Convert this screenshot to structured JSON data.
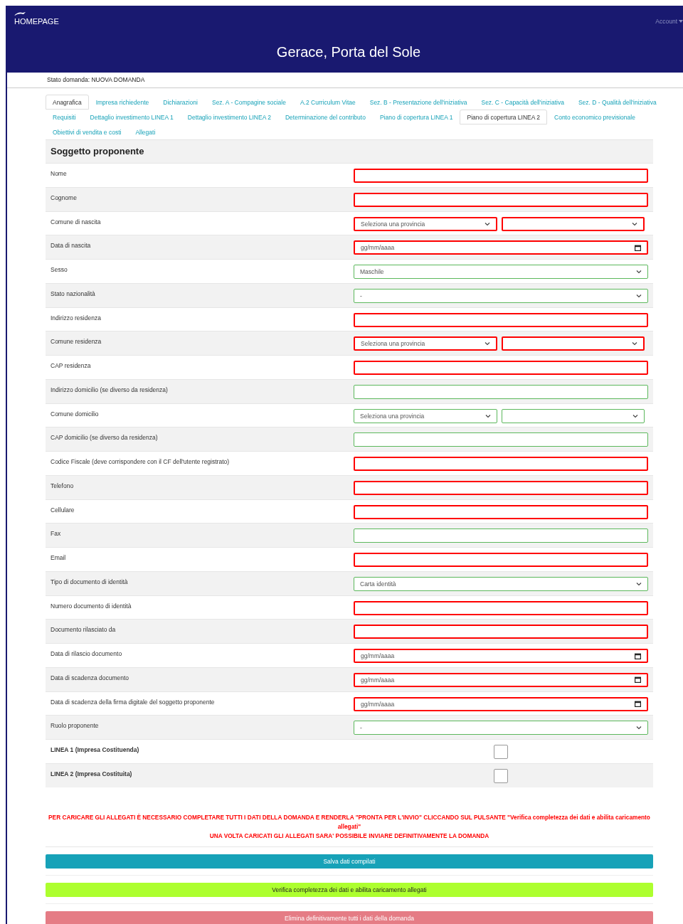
{
  "header": {
    "brand": "HOMEPAGE",
    "account": "Account",
    "title": "Gerace, Porta del Sole"
  },
  "status": "Stato domanda: NUOVA DOMANDA",
  "tabs": [
    [
      {
        "label": "Anagrafica",
        "selected": true
      },
      {
        "label": "Impresa richiedente",
        "selected": false
      },
      {
        "label": "Dichiarazioni",
        "selected": false
      },
      {
        "label": "Sez. A - Compagine sociale",
        "selected": false
      },
      {
        "label": "A.2 Curriculum Vitae",
        "selected": false
      },
      {
        "label": "Sez. B - Presentazione dell'iniziativa",
        "selected": false
      },
      {
        "label": "Sez. C - Capacità dell'iniziativa",
        "selected": false
      },
      {
        "label": "Sez. D - Qualità dell'iniziativa",
        "selected": false
      }
    ],
    [
      {
        "label": "Requisiti",
        "selected": false
      },
      {
        "label": "Dettaglio investimento LINEA 1",
        "selected": false
      },
      {
        "label": "Dettaglio investimento LINEA 2",
        "selected": false
      },
      {
        "label": "Determinazione del contributo",
        "selected": false
      },
      {
        "label": "Piano di copertura LINEA 1",
        "selected": false
      },
      {
        "label": "Piano di copertura LINEA 2",
        "selected": true
      },
      {
        "label": "Conto economico previsionale",
        "selected": false
      }
    ],
    [
      {
        "label": "Obiettivi di vendita e costi",
        "selected": false
      },
      {
        "label": "Allegati",
        "selected": false
      }
    ]
  ],
  "section": "Soggetto proponente",
  "rows": [
    {
      "label": "Nome",
      "kind": "text",
      "valid": false
    },
    {
      "label": "Cognome",
      "kind": "text",
      "valid": false
    },
    {
      "label": "Comune di nascita",
      "kind": "province",
      "valid": false,
      "value": "Seleziona una provincia"
    },
    {
      "label": "Data di nascita",
      "kind": "date",
      "valid": false,
      "value": "gg/mm/aaaa"
    },
    {
      "label": "Sesso",
      "kind": "select",
      "valid": true,
      "value": "Maschile"
    },
    {
      "label": "Stato nazionalità",
      "kind": "select",
      "valid": true,
      "value": "-"
    },
    {
      "label": "Indirizzo residenza",
      "kind": "text",
      "valid": false
    },
    {
      "label": "Comune residenza",
      "kind": "province",
      "valid": false,
      "value": "Seleziona una provincia"
    },
    {
      "label": "CAP residenza",
      "kind": "text",
      "valid": false
    },
    {
      "label": "Indirizzo domicilio (se diverso da residenza)",
      "kind": "text",
      "valid": true
    },
    {
      "label": "Comune domicilio",
      "kind": "province",
      "valid": true,
      "value": "Seleziona una provincia"
    },
    {
      "label": "CAP domicilio (se diverso da residenza)",
      "kind": "text",
      "valid": true
    },
    {
      "label": "Codice Fiscale (deve corrispondere con il CF dell'utente registrato)",
      "kind": "text",
      "valid": false
    },
    {
      "label": "Telefono",
      "kind": "text",
      "valid": false
    },
    {
      "label": "Cellulare",
      "kind": "text",
      "valid": false
    },
    {
      "label": "Fax",
      "kind": "text",
      "valid": true
    },
    {
      "label": "Email",
      "kind": "text",
      "valid": false
    },
    {
      "label": "Tipo di documento di identità",
      "kind": "select",
      "valid": true,
      "value": "Carta identità"
    },
    {
      "label": "Numero documento di identità",
      "kind": "text",
      "valid": false
    },
    {
      "label": "Documento rilasciato da",
      "kind": "text",
      "valid": false
    },
    {
      "label": "Data di rilascio documento",
      "kind": "date",
      "valid": false,
      "value": "gg/mm/aaaa"
    },
    {
      "label": "Data di scadenza documento",
      "kind": "date",
      "valid": false,
      "value": "gg/mm/aaaa"
    },
    {
      "label": "Data di scadenza della firma digitale del soggetto proponente",
      "kind": "date",
      "valid": false,
      "value": "gg/mm/aaaa"
    },
    {
      "label": "Ruolo proponente",
      "kind": "select",
      "valid": true,
      "value": "-"
    },
    {
      "label": "LINEA 1 (Impresa Costituenda)",
      "kind": "checkbox",
      "checked": false
    },
    {
      "label": "LINEA 2 (Impresa Costituita)",
      "kind": "checkbox",
      "checked": false
    }
  ],
  "notice": [
    "PER CARICARE GLI ALLEGATI È NECESSARIO COMPLETARE TUTTI I DATI DELLA DOMANDA E RENDERLA \"PRONTA PER L'INVIO\" CLICCANDO SUL PULSANTE \"Verifica completezza dei dati e abilita caricamento allegati\"",
    "UNA VOLTA CARICATI GLI ALLEGATI SARA' POSSIBILE INVIARE DEFINITIVAMENTE LA DOMANDA"
  ],
  "buttons": [
    {
      "label": "Salva dati compilati",
      "kind": "save"
    },
    {
      "label": "Verifica completezza dei dati e abilita caricamento allegati",
      "kind": "verify"
    },
    {
      "label": "Elimina definitivamente tutti i dati della domanda",
      "kind": "delete"
    }
  ]
}
